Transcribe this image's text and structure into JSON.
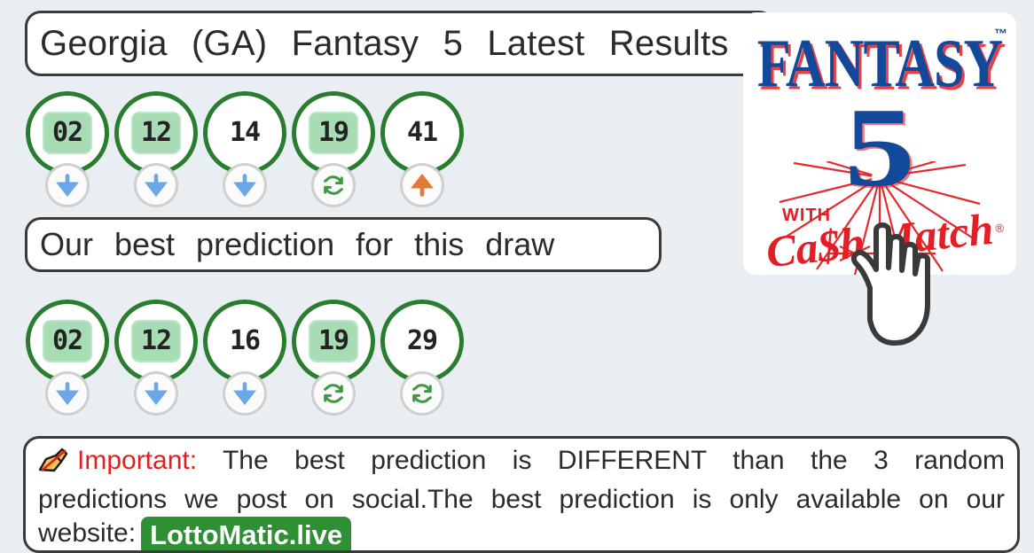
{
  "page": {
    "background_color": "#e9eef2"
  },
  "header": {
    "title": "Georgia   (GA)   Fantasy   5 Latest   Results"
  },
  "logo": {
    "name": "fantasy-5-cash-match-logo",
    "word_top": "FANTASY",
    "trademark": "™",
    "number": "5",
    "with_text": "WITH",
    "brand": "Ca$h Match",
    "registered": "®",
    "colors": {
      "blue": "#12499b",
      "red": "#e31e24"
    }
  },
  "cursor": {
    "type": "pointing-hand"
  },
  "results": {
    "section_name": "latest-results",
    "balls": [
      {
        "number": "02",
        "highlighted": true,
        "trend": "down"
      },
      {
        "number": "12",
        "highlighted": true,
        "trend": "down"
      },
      {
        "number": "14",
        "highlighted": false,
        "trend": "down"
      },
      {
        "number": "19",
        "highlighted": true,
        "trend": "repeat"
      },
      {
        "number": "41",
        "highlighted": false,
        "trend": "up"
      }
    ]
  },
  "prediction": {
    "label": "Our   best   prediction    for  this   draw",
    "balls": [
      {
        "number": "02",
        "highlighted": true,
        "trend": "down"
      },
      {
        "number": "12",
        "highlighted": true,
        "trend": "down"
      },
      {
        "number": "16",
        "highlighted": false,
        "trend": "down"
      },
      {
        "number": "19",
        "highlighted": true,
        "trend": "repeat"
      },
      {
        "number": "29",
        "highlighted": false,
        "trend": "repeat"
      }
    ]
  },
  "notice": {
    "icon": "writing-hand-icon",
    "label": "Important:",
    "body_1": "The   best   prediction    is DIFFERENT     than   the   3   random    predictions     we  post   on social.The     best   prediction    is only   available    on  our  website:",
    "site": "LottoMatic.live"
  },
  "colors": {
    "ball_ring": "#2a7d2e",
    "highlight": "#a8dcb4",
    "down_arrow": "#6aa6e8",
    "up_arrow": "#e07b35",
    "repeat_arrow": "#3f9944",
    "badge_green": "#2f8f35",
    "important_red": "#e02020"
  }
}
